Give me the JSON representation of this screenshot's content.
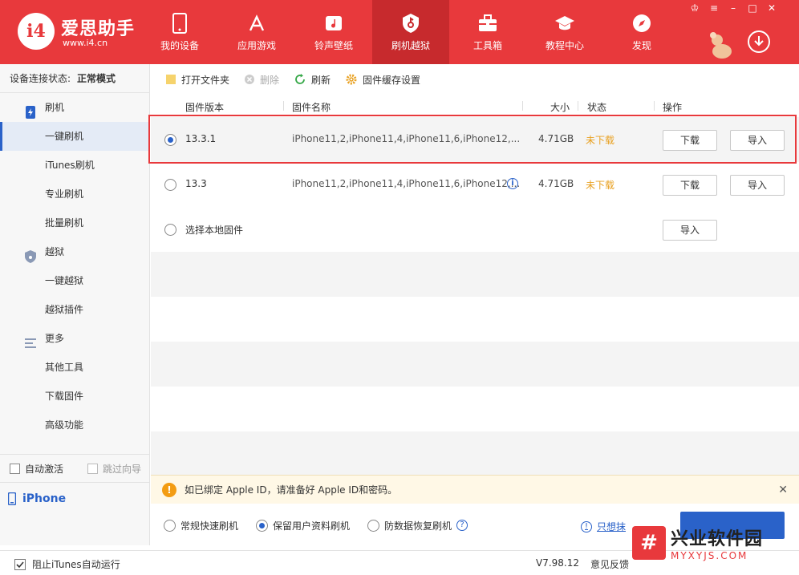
{
  "app": {
    "brand_title": "爱思助手",
    "brand_url": "www.i4.cn",
    "logo_text": "i4",
    "accent_color": "#e8393c",
    "highlight_color": "#2a62c9"
  },
  "nav": [
    {
      "label": "我的设备",
      "icon": "phone-icon"
    },
    {
      "label": "应用游戏",
      "icon": "appstore-icon"
    },
    {
      "label": "铃声壁纸",
      "icon": "music-icon"
    },
    {
      "label": "刷机越狱",
      "icon": "flash-icon",
      "active": true
    },
    {
      "label": "工具箱",
      "icon": "toolbox-icon"
    },
    {
      "label": "教程中心",
      "icon": "graduation-cap-icon"
    },
    {
      "label": "发现",
      "icon": "compass-icon"
    }
  ],
  "sidebar": {
    "conn_label": "设备连接状态:",
    "conn_value": "正常模式",
    "groups": [
      {
        "label": "刷机",
        "icon": "flash-phone-icon"
      },
      {
        "label": "越狱",
        "icon": "shield-icon"
      },
      {
        "label": "更多",
        "icon": "menu-icon"
      }
    ],
    "items": [
      "一键刷机",
      "iTunes刷机",
      "专业刷机",
      "批量刷机",
      "一键越狱",
      "越狱插件",
      "其他工具",
      "下载固件",
      "高级功能"
    ],
    "auto_activate": "自动激活",
    "skip_guide": "跳过向导",
    "device": "iPhone"
  },
  "toolbar": {
    "open_folder": "打开文件夹",
    "delete": "删除",
    "refresh": "刷新",
    "cache_settings": "固件缓存设置"
  },
  "table": {
    "headers": {
      "version": "固件版本",
      "name": "固件名称",
      "size": "大小",
      "status": "状态",
      "action": "操作"
    },
    "rows": [
      {
        "version": "13.3.1",
        "name": "iPhone11,2,iPhone11,4,iPhone11,6,iPhone12,...",
        "size": "4.71GB",
        "status": "未下载",
        "download": "下载",
        "import": "导入",
        "selected": true
      },
      {
        "version": "13.3",
        "name": "iPhone11,2,iPhone11,4,iPhone11,6,iPhone12,...",
        "size": "4.71GB",
        "status": "未下载",
        "download": "下载",
        "import": "导入",
        "selected": false
      },
      {
        "version": "选择本地固件",
        "import": "导入"
      }
    ]
  },
  "notice": {
    "text": "如已绑定 Apple ID，请准备好 Apple ID和密码。"
  },
  "options": {
    "quick": "常规快速刷机",
    "keep": "保留用户资料刷机",
    "recovery": "防数据恢复刷机",
    "only_wipe": "只想抹"
  },
  "statusbar": {
    "block_itunes": "阻止iTunes自动运行",
    "version": "V7.98.12",
    "feedback": "意见反馈"
  },
  "watermark": {
    "cn": "兴业软件园",
    "en": "MYXYJS.COM"
  }
}
